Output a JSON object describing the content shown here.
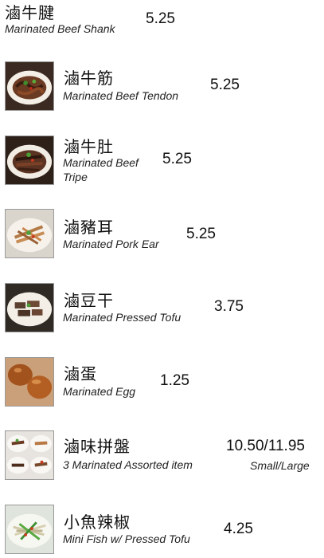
{
  "menu": {
    "items": [
      {
        "zh": "滷牛腱",
        "en": "Marinated Beef Shank",
        "price": "5.25",
        "image": "beef-shank-photo"
      },
      {
        "zh": "滷牛筋",
        "en": "Marinated Beef Tendon",
        "price": "5.25",
        "image": "beef-tendon-photo"
      },
      {
        "zh": "滷牛肚",
        "en": "Marinated Beef Tripe",
        "price": "5.25",
        "image": "beef-tripe-photo"
      },
      {
        "zh": "滷豬耳",
        "en": "Marinated Pork Ear",
        "price": "5.25",
        "image": "pork-ear-photo"
      },
      {
        "zh": "滷豆干",
        "en": "Marinated Pressed Tofu",
        "price": "3.75",
        "image": "pressed-tofu-photo"
      },
      {
        "zh": "滷蛋",
        "en": "Marinated Egg",
        "price": "1.25",
        "image": "marinated-egg-photo"
      },
      {
        "zh": "滷味拼盤",
        "en": "3 Marinated Assorted item",
        "price": "10.50/11.95",
        "size_note": "Small/Large",
        "image": "assorted-platter-photo"
      },
      {
        "zh": "小魚辣椒",
        "en": "Mini Fish w/ Pressed Tofu",
        "price": "4.25",
        "image": "mini-fish-photo"
      }
    ]
  }
}
